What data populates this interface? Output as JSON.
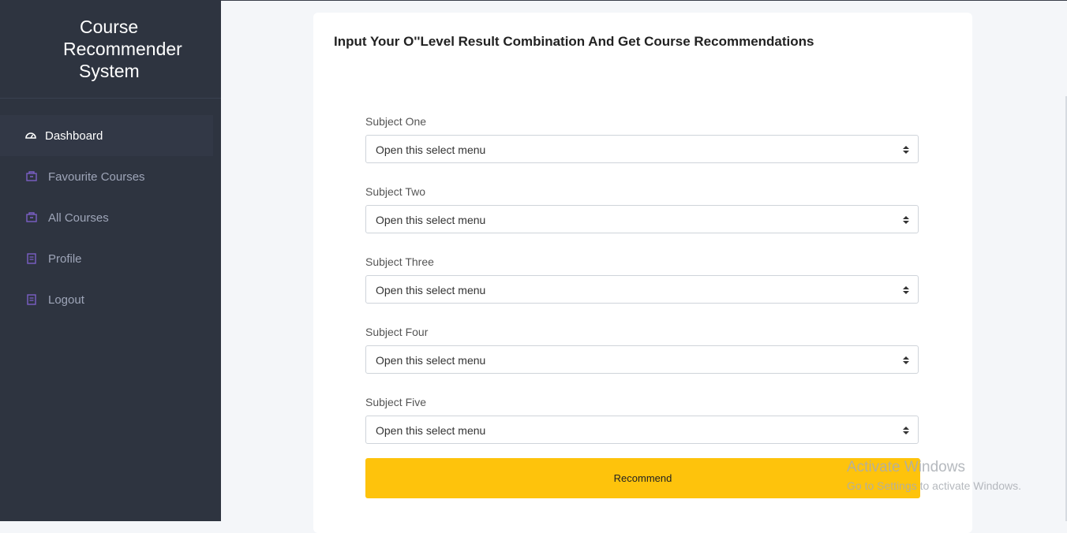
{
  "app": {
    "title_lines": [
      "Course",
      "Recommender",
      "System"
    ]
  },
  "sidebar": {
    "items": [
      {
        "label": "Dashboard",
        "icon": "gauge-icon",
        "active": true
      },
      {
        "label": "Favourite Courses",
        "icon": "box-icon",
        "active": false
      },
      {
        "label": "All Courses",
        "icon": "box-icon",
        "active": false
      },
      {
        "label": "Profile",
        "icon": "document-icon",
        "active": false
      },
      {
        "label": "Logout",
        "icon": "document-icon",
        "active": false
      }
    ]
  },
  "main": {
    "title": "Input Your O''Level Result Combination And Get Course Recommendations",
    "fields": [
      {
        "label": "Subject One",
        "value": "Open this select menu"
      },
      {
        "label": "Subject Two",
        "value": "Open this select menu"
      },
      {
        "label": "Subject Three",
        "value": "Open this select menu"
      },
      {
        "label": "Subject Four",
        "value": "Open this select menu"
      },
      {
        "label": "Subject Five",
        "value": "Open this select menu"
      }
    ],
    "submit_label": "Recommend"
  },
  "watermark": {
    "title": "Activate Windows",
    "subtitle": "Go to Settings to activate Windows."
  },
  "colors": {
    "sidebar_bg": "#2e3440",
    "accent_icon": "#7b5fc7",
    "button": "#fec30c",
    "page_bg": "#f4f6f9"
  }
}
